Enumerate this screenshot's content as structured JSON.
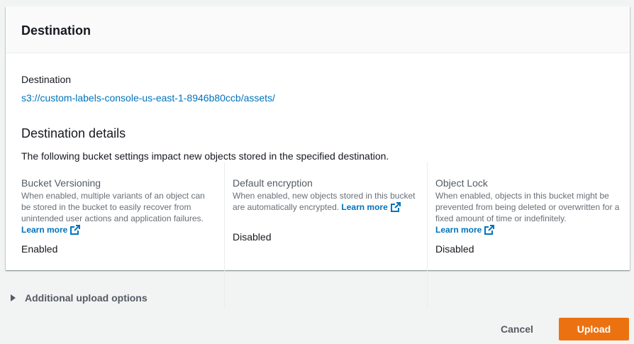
{
  "destination_card": {
    "title": "Destination",
    "destination_label": "Destination",
    "destination_url": "s3://custom-labels-console-us-east-1-8946b80ccb/assets/",
    "details_title": "Destination details",
    "details_description": "The following bucket settings impact new objects stored in the specified destination.",
    "columns": [
      {
        "title": "Bucket Versioning",
        "help": "When enabled, multiple variants of an object can be stored in the bucket to easily recover from unintended user actions and application failures.",
        "learn_more": "Learn more",
        "value": "Enabled"
      },
      {
        "title": "Default encryption",
        "help": "When enabled, new objects stored in this bucket are automatically encrypted.",
        "learn_more": "Learn more",
        "value": "Disabled"
      },
      {
        "title": "Object Lock",
        "help": "When enabled, objects in this bucket might be prevented from being deleted or overwritten for a fixed amount of time or indefinitely.",
        "learn_more": "Learn more",
        "value": "Disabled"
      }
    ]
  },
  "additional_options": {
    "label": "Additional upload options",
    "icon": "caret-right-icon"
  },
  "actions": {
    "cancel_label": "Cancel",
    "upload_label": "Upload"
  },
  "colors": {
    "link": "#0073bb",
    "primary": "#ec7211",
    "background": "#f2f3f3"
  }
}
